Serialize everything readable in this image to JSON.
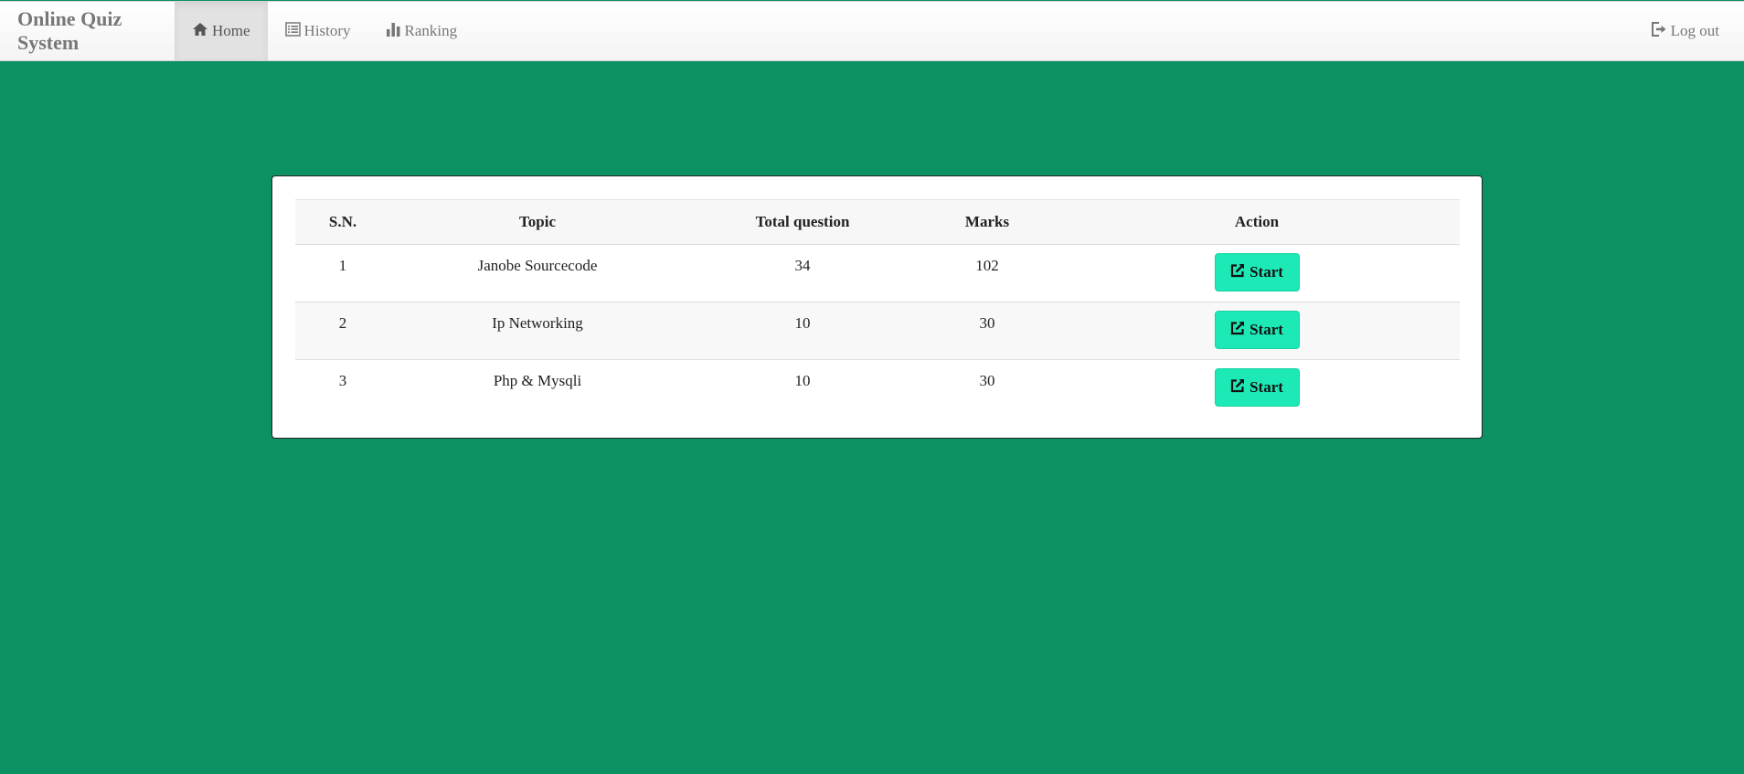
{
  "navbar": {
    "brand": "Online Quiz System",
    "items": [
      {
        "label": "Home",
        "icon": "home-icon",
        "active": true
      },
      {
        "label": "History",
        "icon": "list-icon",
        "active": false
      },
      {
        "label": "Ranking",
        "icon": "bar-chart-icon",
        "active": false
      }
    ],
    "logout": {
      "label": "Log out",
      "icon": "logout-icon"
    }
  },
  "table": {
    "headers": [
      "S.N.",
      "Topic",
      "Total question",
      "Marks",
      "Action"
    ],
    "rows": [
      {
        "sn": "1",
        "topic": "Janobe Sourcecode",
        "total": "34",
        "marks": "102",
        "action": "Start"
      },
      {
        "sn": "2",
        "topic": "Ip Networking",
        "total": "10",
        "marks": "30",
        "action": "Start"
      },
      {
        "sn": "3",
        "topic": "Php & Mysqli",
        "total": "10",
        "marks": "30",
        "action": "Start"
      }
    ]
  },
  "colors": {
    "background": "#0c9163",
    "start_button": "#1de9b6"
  }
}
